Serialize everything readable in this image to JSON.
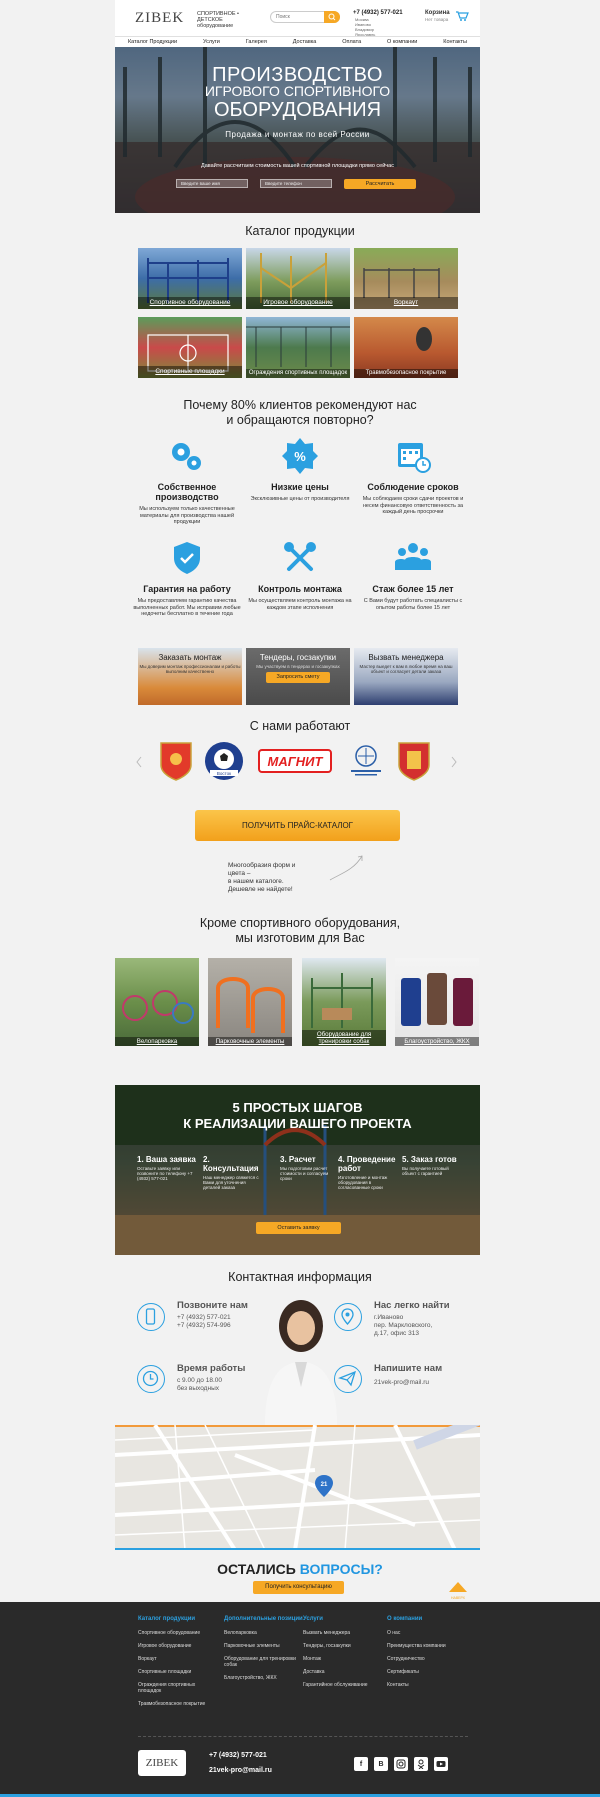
{
  "header": {
    "logo": "ZIBEK",
    "tagline_line1": "СПОРТИВНОЕ • ДЕТСКОЕ",
    "tagline_line2": "оборудование",
    "search_placeholder": "Поиск",
    "phone": "+7 (4932) 577-021",
    "phone_list": [
      "Москва",
      "Иваново",
      "Владимир",
      "Ярославль"
    ],
    "cart_title": "Корзина",
    "cart_sub": "Нет товара"
  },
  "nav": [
    "Каталог Продукции",
    "Услуги",
    "Галерея",
    "Доставка",
    "Оплата",
    "О компании",
    "Контакты"
  ],
  "hero": {
    "line1": "ПРОИЗВОДСТВО",
    "line2": "ИГРОВОГО СПОРТИВНОГО",
    "line3": "ОБОРУДОВАНИЯ",
    "subtitle": "Продажа и монтаж по всей России",
    "cta_text": "Давайте рассчитаем стоимость вашей спортивной площадки прямо сейчас",
    "input1": "Введите ваше имя",
    "input2": "Введите телефон",
    "button": "Рассчитать"
  },
  "catalog": {
    "title": "Каталог продукции",
    "items": [
      "Спортивное оборудование",
      "Игровое оборудование",
      "Воркаут",
      "Спортивные площадки",
      "Ограждения спортивных площадок",
      "Травмобезопасное покрытие"
    ]
  },
  "why": {
    "title_line1": "Почему 80% клиентов рекомендуют нас",
    "title_line2": "и обращаются повторно?",
    "items": [
      {
        "title": "Собственное производство",
        "text": "Мы используем только качественные материалы для производства нашей продукции"
      },
      {
        "title": "Низкие цены",
        "text": "Эксклюзивные цены от производителя"
      },
      {
        "title": "Соблюдение сроков",
        "text": "Мы соблюдаем сроки сдачи проектов и несем финансовую ответственность за каждый день просрочки"
      },
      {
        "title": "Гарантия на работу",
        "text": "Мы предоставляем гарантию качества выполненных работ. Мы исправим любые недочеты бесплатно в течение года"
      },
      {
        "title": "Контроль монтажа",
        "text": "Мы осуществляем контроль монтажа на каждом этапе исполнения"
      },
      {
        "title": "Стаж более 15 лет",
        "text": "С Вами будут работать специалисты с опытом работы более 15 лет"
      }
    ]
  },
  "promos": [
    {
      "title": "Заказать монтаж",
      "text": "Мы доверим монтаж профессионалам и работы выполним качественно"
    },
    {
      "title": "Тендеры, госзакупки",
      "text": "Мы участвуем в тендерах и госзакупках",
      "button": "Запросить смету"
    },
    {
      "title": "Вызвать менеджера",
      "text": "Мастер выедет к вам в любое время на ваш объект и согласует детали заказа"
    }
  ],
  "partners": {
    "title": "С нами работают",
    "items": [
      "Герб Иваново",
      "Восток",
      "МАГНИТ",
      "Партнер",
      "Герб Тула"
    ]
  },
  "price": {
    "button": "ПОЛУЧИТЬ ПРАЙС-КАТАЛОГ",
    "note_line1": "Многообразия форм и цвета –",
    "note_line2": "в нашем каталоге.",
    "note_line3": "Дешевле не найдете!"
  },
  "extra": {
    "title_line1": "Кроме спортивного оборудования,",
    "title_line2": "мы изготовим для Вас",
    "items": [
      "Велопарковка",
      "Парковочные элементы",
      "Оборудование для тренировки собак",
      "Благоустройство, ЖКХ"
    ]
  },
  "steps": {
    "title_line1": "5 ПРОСТЫХ ШАГОВ",
    "title_line2": "К РЕАЛИЗАЦИИ ВАШЕГО ПРОЕКТА",
    "items": [
      {
        "title": "1. Ваша заявка",
        "text": "Оставьте заявку или позвоните по телефону +7 (4932) 577-021"
      },
      {
        "title": "2. Консультация",
        "text": "Наш менеджер свяжется с Вами для уточнения деталей заказа"
      },
      {
        "title": "3. Расчет",
        "text": "Мы подготовим расчет стоимости и согласуем сроки"
      },
      {
        "title": "4. Проведение работ",
        "text": "Изготовление и монтаж оборудования в согласованные сроки"
      },
      {
        "title": "5. Заказ готов",
        "text": "Вы получаете готовый объект с гарантией"
      }
    ],
    "button": "Оставить заявку"
  },
  "contacts": {
    "title": "Контактная информация",
    "call_title": "Позвоните нам",
    "call_1": "+7 (4932) 577-021",
    "call_2": "+7 (4932) 574-996",
    "time_title": "Время работы",
    "time_1": "с 9.00 до 18.00",
    "time_2": "без выходных",
    "addr_title": "Нас легко найти",
    "addr_1": "г.Иваново",
    "addr_2": "пер. Маркловского,",
    "addr_3": "д.17, офис 313",
    "mail_title": "Напишите нам",
    "mail_1": "21vek-pro@mail.ru"
  },
  "map": {
    "pin": "21"
  },
  "questions": {
    "title_a": "ОСТАЛИСЬ ",
    "title_b": "ВОПРОСЫ?",
    "button": "Получить консультацию",
    "up_label": "НАВЕРХ"
  },
  "footer": {
    "cols": [
      {
        "title": "Каталог продукции",
        "items": [
          "Спортивное оборудование",
          "Игровое оборудование",
          "Воркаут",
          "Спортивные площадки",
          "Ограждения спортивных площадок",
          "Травмобезопасное покрытие"
        ]
      },
      {
        "title": "Дополнительные позиции",
        "items": [
          "Велопарковка",
          "Парковочные элементы",
          "Оборудование для тренировки собак",
          "Благоустройство, ЖКХ"
        ]
      },
      {
        "title": "Услуги",
        "items": [
          "Вызвать менеджера",
          "Тендеры, госзакупки",
          "Монтаж",
          "Доставка",
          "Гарантийное обслуживание"
        ]
      },
      {
        "title": "О компании",
        "items": [
          "О нас",
          "Преимущества компании",
          "Сотрудничество",
          "Сертификаты",
          "Контакты"
        ]
      }
    ],
    "phone": "+7 (4932) 577-021",
    "email": "21vek-pro@mail.ru",
    "social": [
      "f",
      "B",
      "ig",
      "ok",
      "yt"
    ]
  }
}
